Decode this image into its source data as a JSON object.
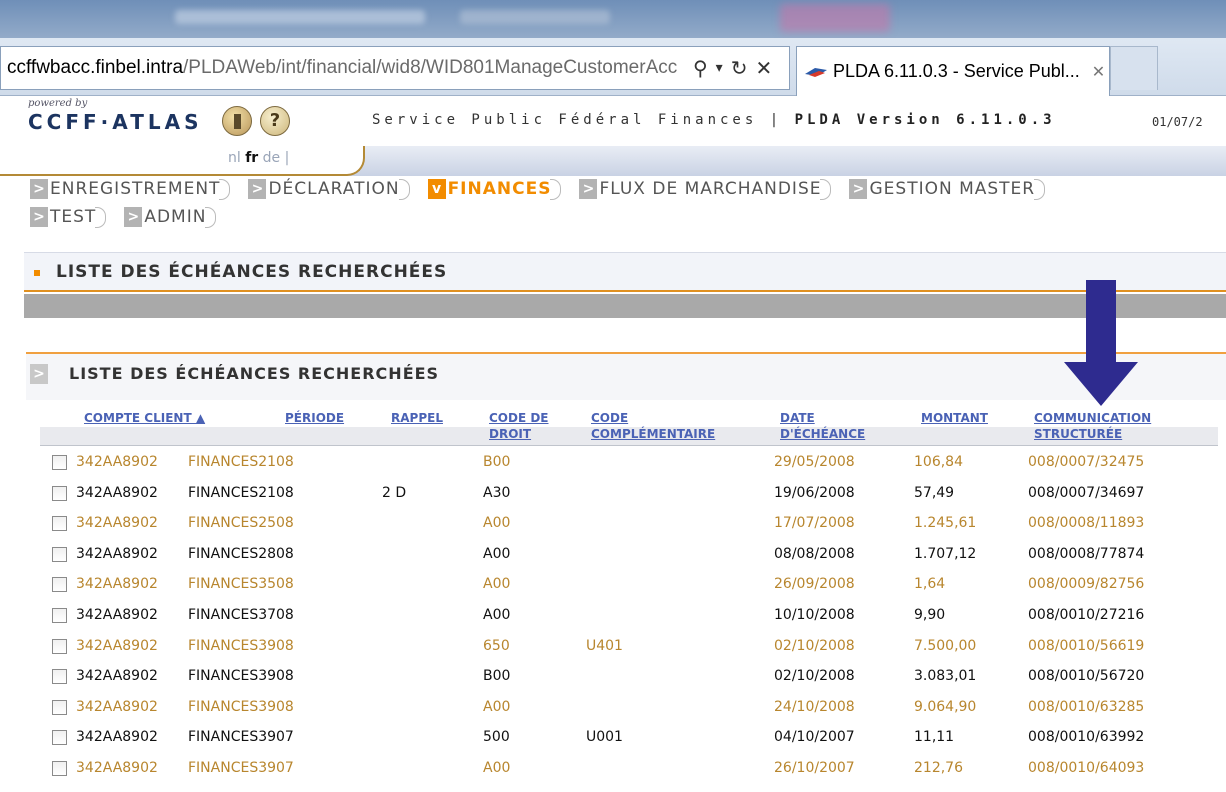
{
  "browser": {
    "url_host": "ccffwbacc.finbel.intra",
    "url_path": "/PLDAWeb/int/financial/wid8/WID801ManageCustomerAcc",
    "tab_title": "PLDA 6.11.0.3 - Service Publ...",
    "search_glyph": "⚲",
    "dropdown_glyph": "▾",
    "refresh_glyph": "↻",
    "close_glyph": "✕",
    "tab_close_glyph": "✕"
  },
  "header": {
    "powered_by": "powered by",
    "logo": "CCFF·ATLAS",
    "help_glyph": "?",
    "service_prefix": "Service Public Fédéral Finances | ",
    "service_version": "PLDA Version 6.11.0.3",
    "date": "01/07/2"
  },
  "languages": {
    "nl": "nl",
    "fr": "fr",
    "de": "de",
    "sep": "|"
  },
  "menu": {
    "chevron": ">",
    "chevron_open": "v",
    "row1": [
      {
        "label": "ENREGISTREMENT"
      },
      {
        "label": "DÉCLARATION"
      },
      {
        "label": "FINANCES"
      },
      {
        "label": "FLUX DE MARCHANDISE"
      },
      {
        "label": "GESTION MASTER"
      }
    ],
    "row2": [
      {
        "label": "TEST"
      },
      {
        "label": "ADMIN"
      }
    ]
  },
  "page": {
    "section_title": "LISTE DES ÉCHÉANCES RECHERCHÉES",
    "panel_title": "LISTE DES ÉCHÉANCES RECHERCHÉES"
  },
  "table": {
    "headers": {
      "compte_client": "COMPTE CLIENT ▲",
      "periode": "PÉRIODE",
      "rappel": "RAPPEL",
      "code_droit_1": "CODE DE",
      "code_droit_2": "DROIT",
      "code_comp_1": "CODE",
      "code_comp_2": "COMPLÉMENTAIRE",
      "date_1": "DATE",
      "date_2": "D'ÉCHÉANCE",
      "montant": "MONTANT",
      "comm_1": "COMMUNICATION",
      "comm_2": "STRUCTURÉE"
    },
    "rows": [
      {
        "compte": "342AA8902",
        "periode": "FINANCES2108",
        "rappel": "",
        "droit": "B00",
        "comp": "",
        "date": "29/05/2008",
        "montant": "106,84",
        "comm": "008/0007/32475"
      },
      {
        "compte": "342AA8902",
        "periode": "FINANCES2108",
        "rappel": "2  D",
        "droit": "A30",
        "comp": "",
        "date": "19/06/2008",
        "montant": "57,49",
        "comm": "008/0007/34697"
      },
      {
        "compte": "342AA8902",
        "periode": "FINANCES2508",
        "rappel": "",
        "droit": "A00",
        "comp": "",
        "date": "17/07/2008",
        "montant": "1.245,61",
        "comm": "008/0008/11893"
      },
      {
        "compte": "342AA8902",
        "periode": "FINANCES2808",
        "rappel": "",
        "droit": "A00",
        "comp": "",
        "date": "08/08/2008",
        "montant": "1.707,12",
        "comm": "008/0008/77874"
      },
      {
        "compte": "342AA8902",
        "periode": "FINANCES3508",
        "rappel": "",
        "droit": "A00",
        "comp": "",
        "date": "26/09/2008",
        "montant": "1,64",
        "comm": "008/0009/82756"
      },
      {
        "compte": "342AA8902",
        "periode": "FINANCES3708",
        "rappel": "",
        "droit": "A00",
        "comp": "",
        "date": "10/10/2008",
        "montant": "9,90",
        "comm": "008/0010/27216"
      },
      {
        "compte": "342AA8902",
        "periode": "FINANCES3908",
        "rappel": "",
        "droit": "650",
        "comp": "U401",
        "date": "02/10/2008",
        "montant": "7.500,00",
        "comm": "008/0010/56619"
      },
      {
        "compte": "342AA8902",
        "periode": "FINANCES3908",
        "rappel": "",
        "droit": "B00",
        "comp": "",
        "date": "02/10/2008",
        "montant": "3.083,01",
        "comm": "008/0010/56720"
      },
      {
        "compte": "342AA8902",
        "periode": "FINANCES3908",
        "rappel": "",
        "droit": "A00",
        "comp": "",
        "date": "24/10/2008",
        "montant": "9.064,90",
        "comm": "008/0010/63285"
      },
      {
        "compte": "342AA8902",
        "periode": "FINANCES3907",
        "rappel": "",
        "droit": "500",
        "comp": "U001",
        "date": "04/10/2007",
        "montant": "11,11",
        "comm": "008/0010/63992"
      },
      {
        "compte": "342AA8902",
        "periode": "FINANCES3907",
        "rappel": "",
        "droit": "A00",
        "comp": "",
        "date": "26/10/2007",
        "montant": "212,76",
        "comm": "008/0010/64093"
      }
    ]
  },
  "colors": {
    "accent_orange": "#f28c00",
    "odd_row_text": "#b8862e",
    "header_link": "#4a62b5",
    "arrow": "#2e2b8f"
  }
}
